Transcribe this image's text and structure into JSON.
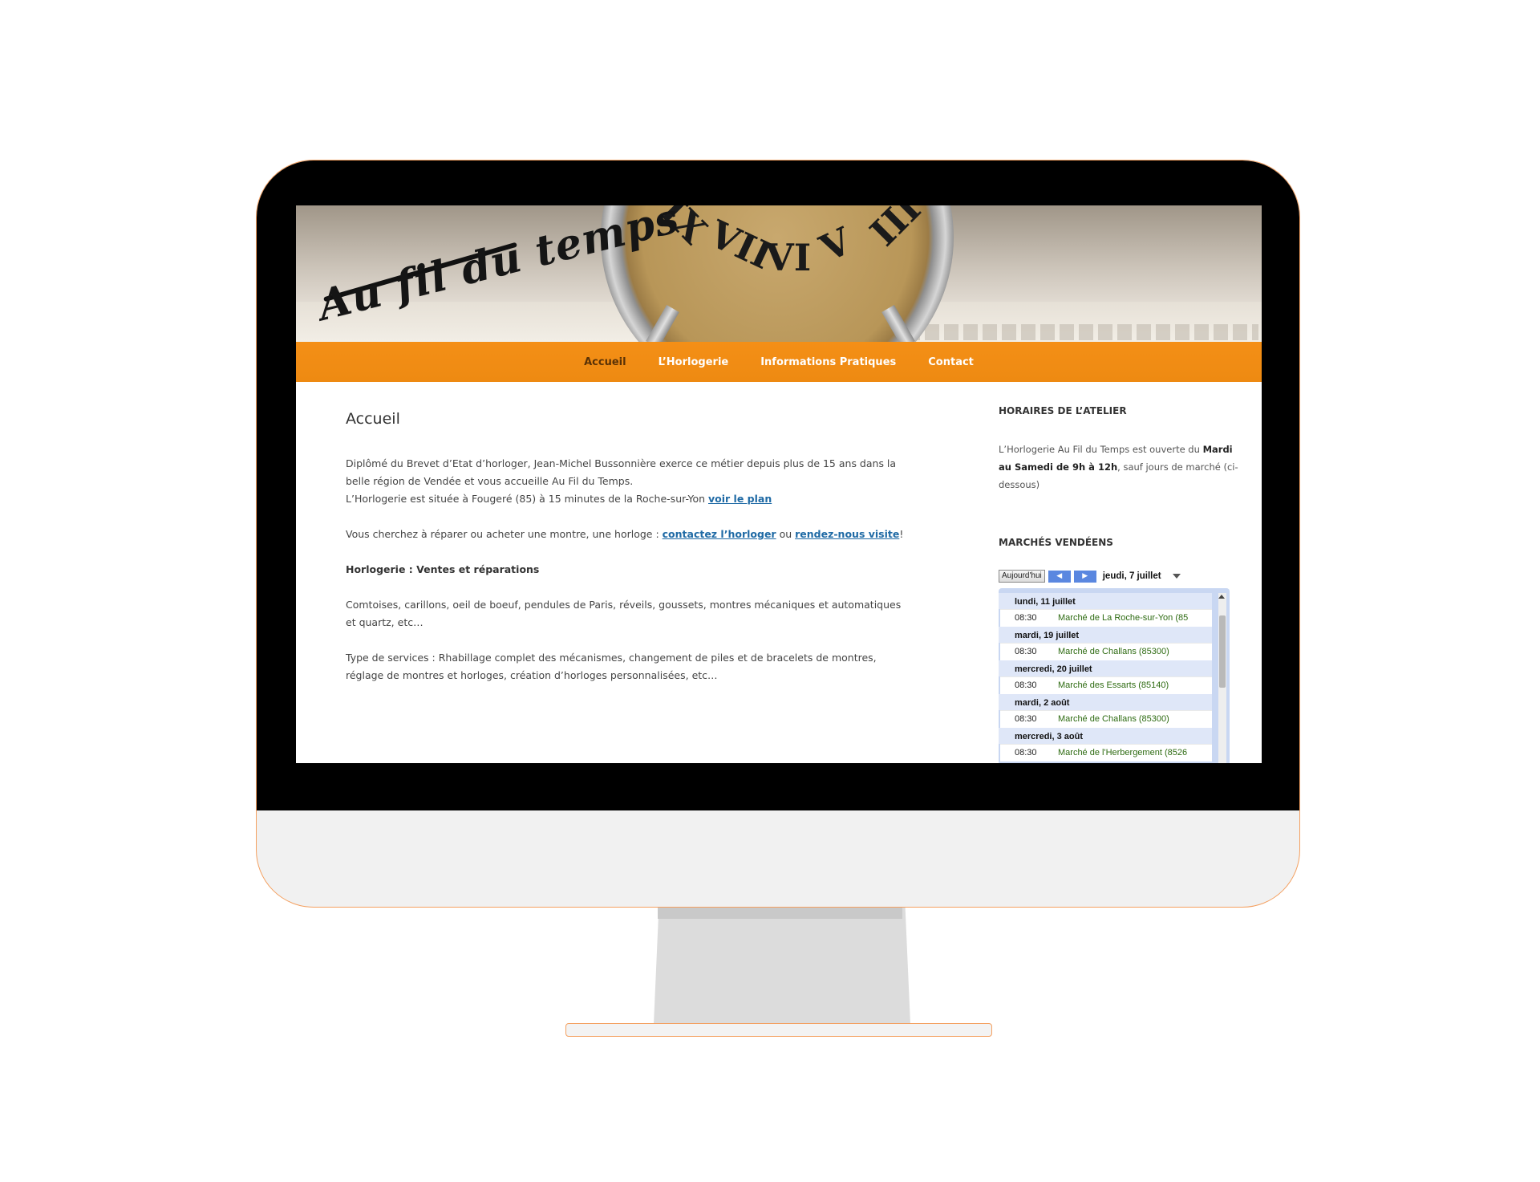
{
  "header": {
    "logo_text": "Au fil du temps"
  },
  "nav": {
    "items": [
      {
        "label": "Accueil"
      },
      {
        "label": "L’Horlogerie"
      },
      {
        "label": "Informations Pratiques"
      },
      {
        "label": "Contact"
      }
    ]
  },
  "main": {
    "title": "Accueil",
    "p1_text": "Diplômé du Brevet d’Etat d’horloger, Jean-Michel Bussonnière exerce ce métier depuis plus de 15 ans dans la belle région de Vendée et vous accueille Au Fil du Temps.",
    "p1_line2": "L’Horlogerie est située à Fougeré (85) à 15 minutes de la Roche-sur-Yon ",
    "p1_link": "voir le plan",
    "p2_text": "Vous cherchez à réparer ou acheter une montre, une horloge : ",
    "p2_link1": "contactez l’horloger",
    "p2_mid": " ou ",
    "p2_link2": "rendez-nous visite",
    "p2_end": "!",
    "heading": "Horlogerie : Ventes et réparations",
    "p3": "Comtoises, carillons, oeil de boeuf, pendules de Paris, réveils, goussets, montres mécaniques et automatiques et quartz, etc…",
    "p4": "Type de services : Rhabillage complet des mécanismes, changement de piles et de bracelets de montres, réglage de montres et horloges, création d’horloges personnalisées, etc…"
  },
  "sidebar": {
    "hours_title": "HORAIRES DE L’ATELIER",
    "hours_pre": "L’Horlogerie Au Fil du Temps est ouverte du ",
    "hours_bold": "Mardi au Samedi de 9h à 12h",
    "hours_post": ", sauf jours de marché (ci-dessous)",
    "markets_title": "MARCHÉS VENDÉENS",
    "calendar": {
      "today_label": "Aujourd'hui",
      "current_date": "jeudi, 7 juillet",
      "days": [
        {
          "label": "lundi, 11 juillet",
          "events": [
            {
              "time": "08:30",
              "title": "Marché de La Roche-sur-Yon (85"
            }
          ]
        },
        {
          "label": "mardi, 19 juillet",
          "events": [
            {
              "time": "08:30",
              "title": "Marché de Challans (85300)"
            }
          ]
        },
        {
          "label": "mercredi, 20 juillet",
          "events": [
            {
              "time": "08:30",
              "title": "Marché des Essarts (85140)"
            }
          ]
        },
        {
          "label": "mardi, 2 août",
          "events": [
            {
              "time": "08:30",
              "title": "Marché de Challans (85300)"
            }
          ]
        },
        {
          "label": "mercredi, 3 août",
          "events": [
            {
              "time": "08:30",
              "title": "Marché de l'Herbergement (8526"
            }
          ]
        }
      ]
    }
  },
  "colors": {
    "nav_orange": "#f28c14",
    "link_blue": "#1f6aa5",
    "event_green": "#2e6b12",
    "monitor_outline": "#f4a060"
  }
}
